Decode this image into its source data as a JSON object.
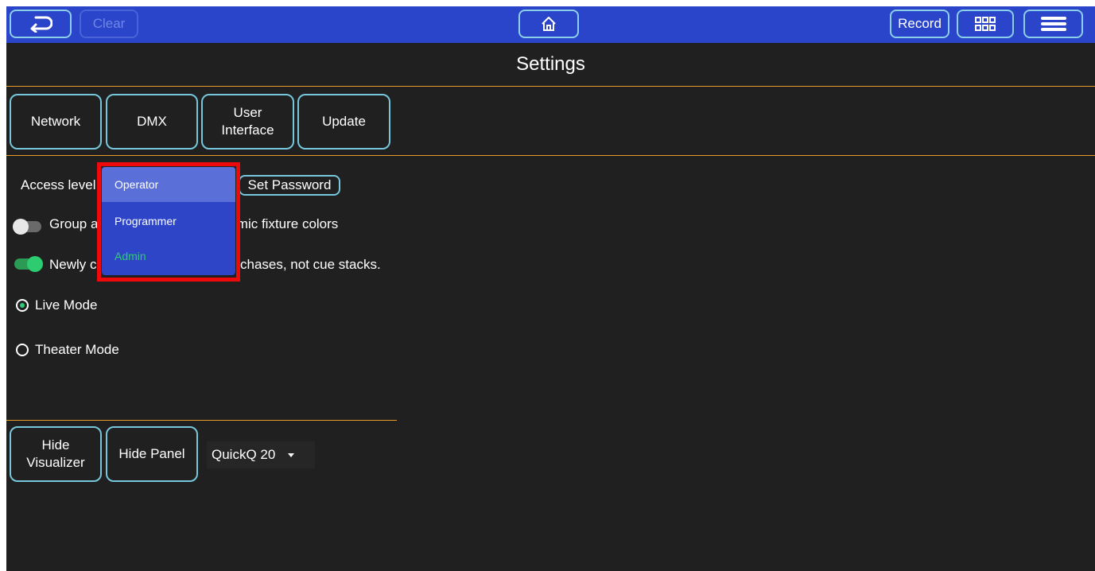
{
  "topbar": {
    "back_icon": "return-arrow-icon",
    "clear_label": "Clear",
    "home_icon": "home-icon",
    "record_label": "Record",
    "grid_icon": "grid-icon",
    "menu_icon": "hamburger-menu-icon"
  },
  "page": {
    "title": "Settings"
  },
  "tabs": [
    {
      "label": "Network"
    },
    {
      "label": "DMX"
    },
    {
      "label_line1": "User",
      "label_line2": "Interface"
    },
    {
      "label": "Update"
    }
  ],
  "access": {
    "label": "Access level",
    "set_password_label": "Set Password",
    "dropdown_options": [
      "Operator",
      "Programmer",
      "Admin"
    ],
    "selected_option": "Operator"
  },
  "settings": {
    "group_toggle_label_start": "Group a",
    "group_toggle_label_end": "imic fixture colors",
    "group_toggle_on": false,
    "newly_toggle_label_start": "Newly c",
    "newly_toggle_label_end": "chases, not cue stacks.",
    "newly_toggle_on": true
  },
  "modes": {
    "live_label": "Live Mode",
    "live_selected": true,
    "theater_label": "Theater Mode",
    "theater_selected": false
  },
  "bottom": {
    "hide_visualizer_line1": "Hide",
    "hide_visualizer_line2": "Visualizer",
    "hide_panel_label": "Hide Panel",
    "device_select_value": "QuickQ 20"
  },
  "colors": {
    "topbar": "#2a45c9",
    "background": "#202020",
    "accent_border": "#76c6dc",
    "divider": "#e89a2a",
    "toggle_on": "#2ecc71",
    "highlight_box": "#ee0a0a",
    "admin_text": "#2ecc71"
  }
}
